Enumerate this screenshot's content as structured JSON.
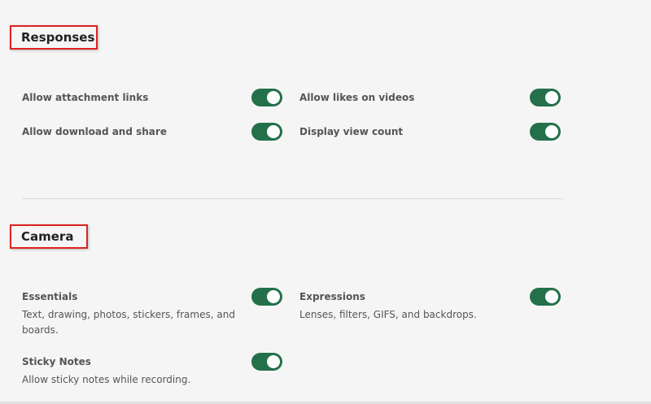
{
  "responses": {
    "title": "Responses",
    "settings": [
      {
        "label": "Allow attachment links",
        "enabled": true
      },
      {
        "label": "Allow likes on videos",
        "enabled": true
      },
      {
        "label": "Allow download and share",
        "enabled": true
      },
      {
        "label": "Display view count",
        "enabled": true
      }
    ]
  },
  "camera": {
    "title": "Camera",
    "settings": [
      {
        "label": "Essentials",
        "description": "Text, drawing, photos, stickers, frames, and boards.",
        "enabled": true
      },
      {
        "label": "Expressions",
        "description": "Lenses, filters, GIFS, and backdrops.",
        "enabled": true
      },
      {
        "label": "Sticky Notes",
        "description": "Allow sticky notes while recording.",
        "enabled": true
      }
    ]
  },
  "colors": {
    "toggle_on": "#24704a",
    "highlight_border": "#dd2222"
  }
}
